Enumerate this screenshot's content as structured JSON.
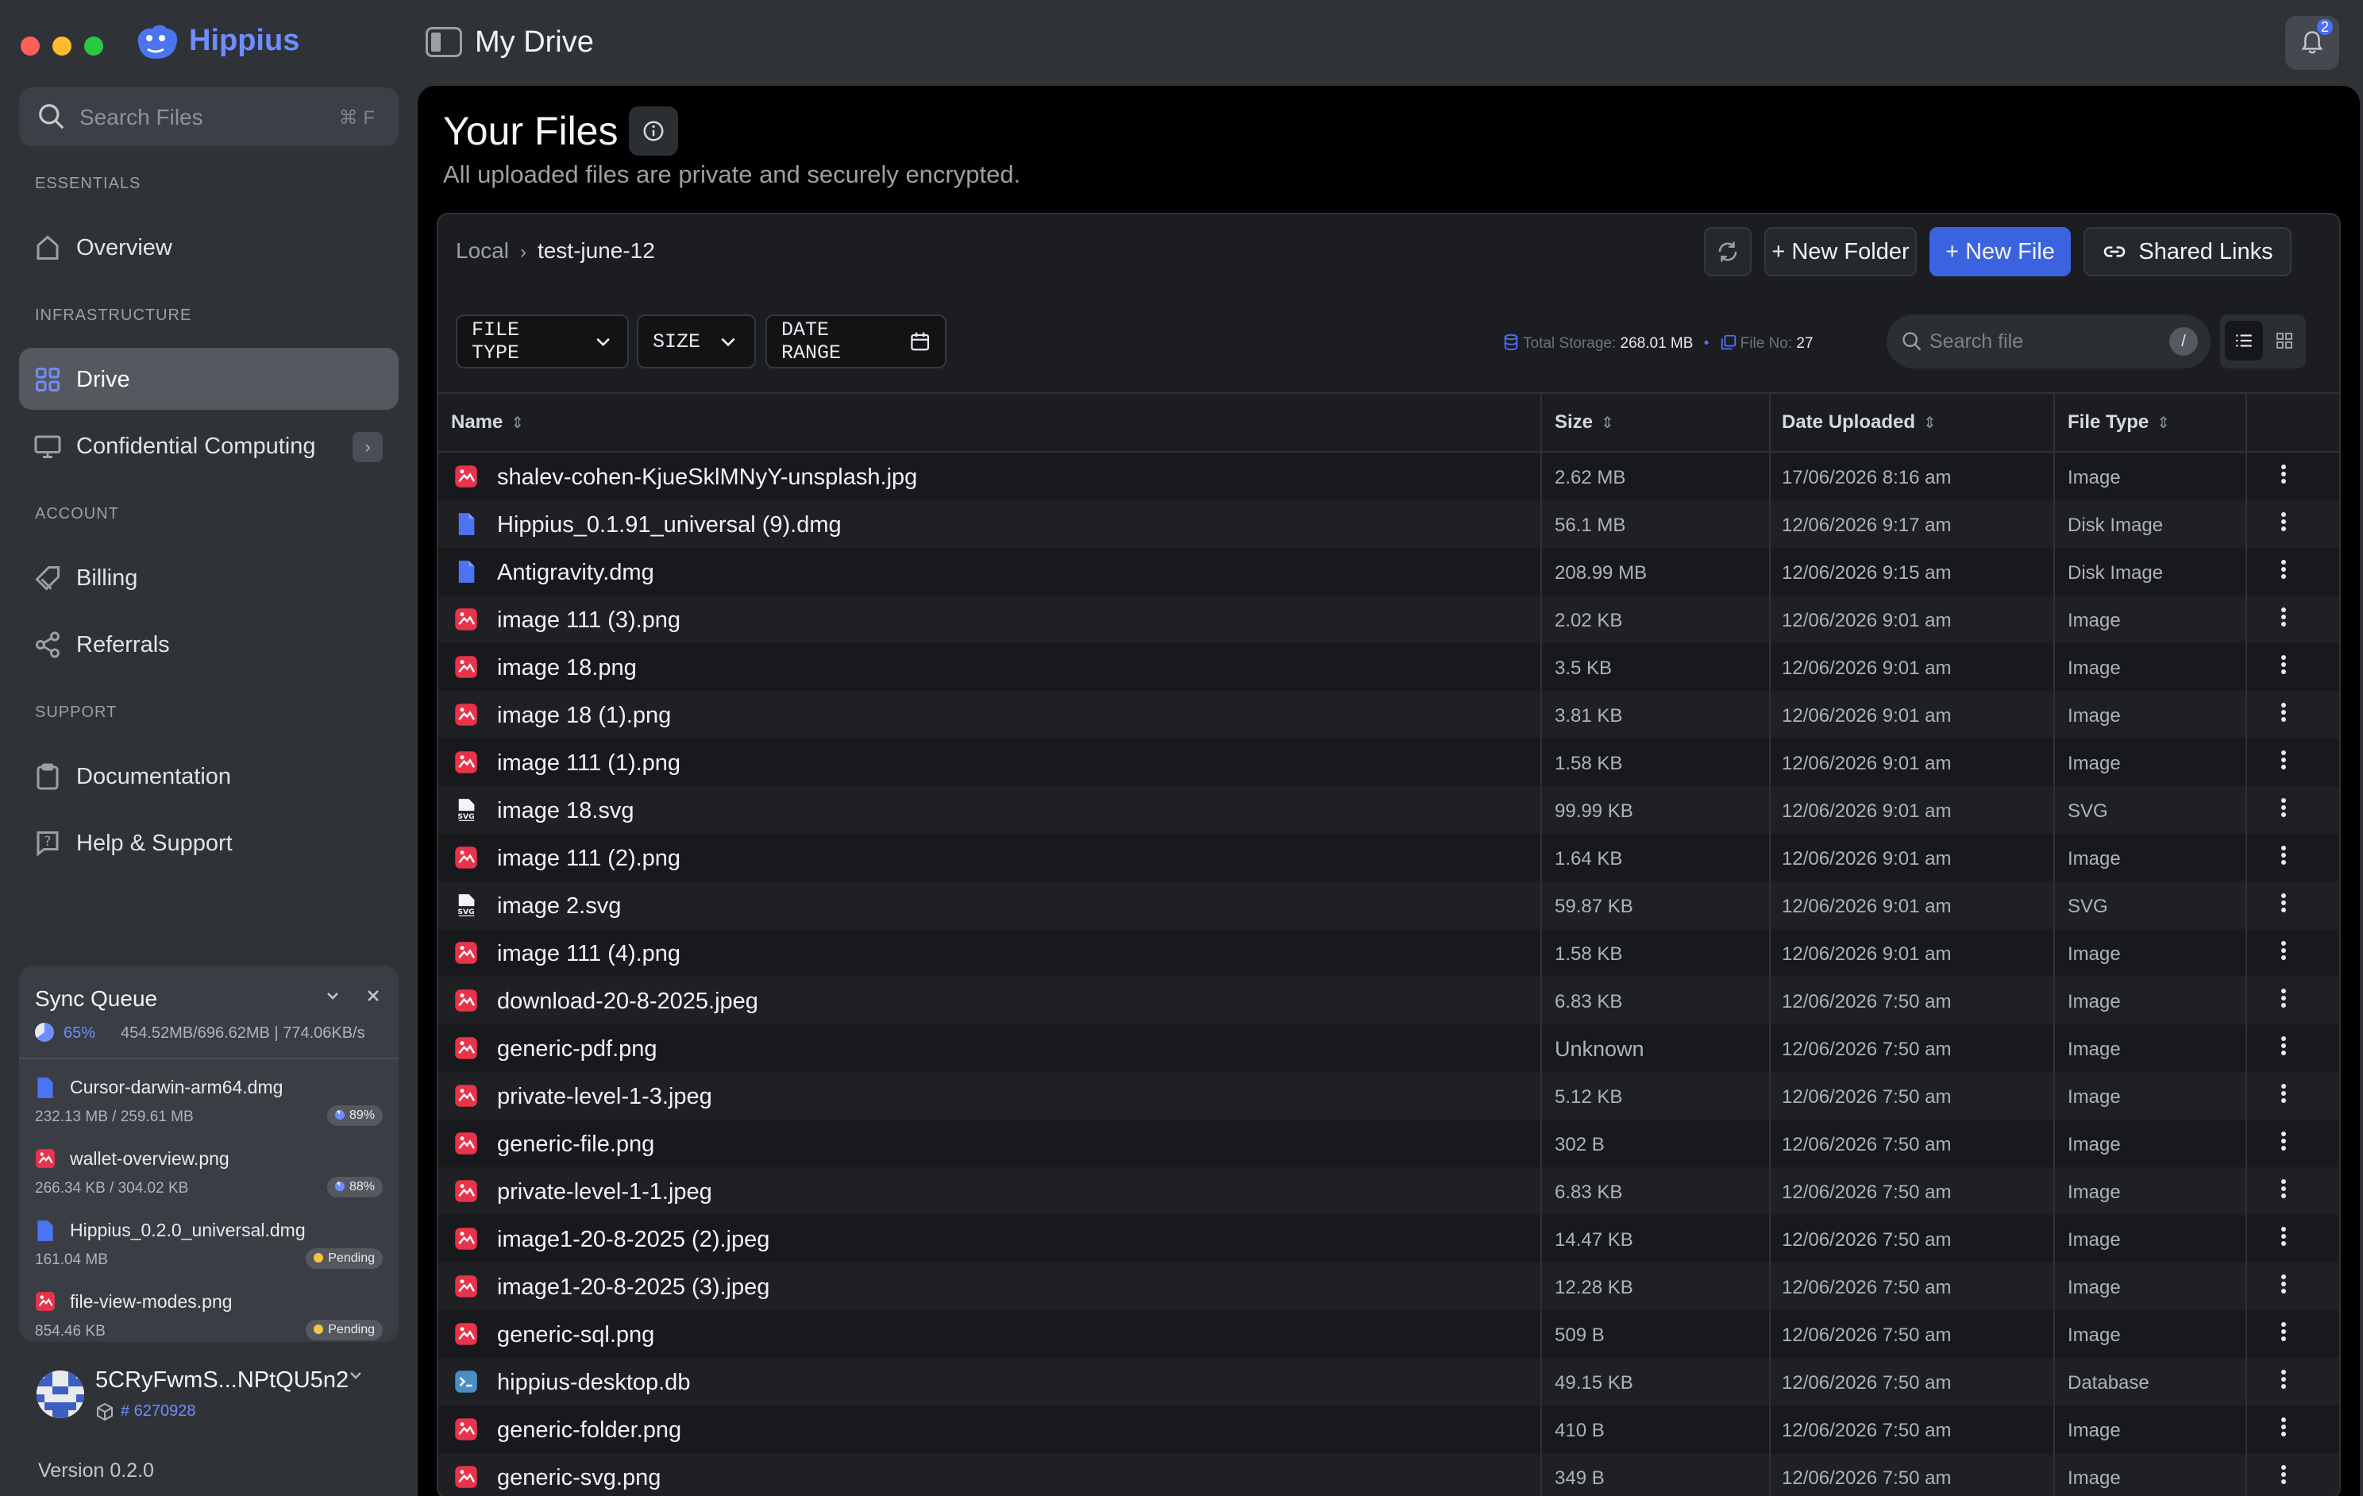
{
  "app": {
    "brand": "Hippius",
    "page_heading": "My Drive",
    "notification_count": "2"
  },
  "sidebar": {
    "search_placeholder": "Search Files",
    "search_shortcut": "⌘ F",
    "sections": {
      "essentials": "ESSENTIALS",
      "infrastructure": "INFRASTRUCTURE",
      "account": "ACCOUNT",
      "support": "SUPPORT"
    },
    "items": {
      "overview": "Overview",
      "drive": "Drive",
      "confidential": "Confidential Computing",
      "billing": "Billing",
      "referrals": "Referrals",
      "documentation": "Documentation",
      "help": "Help & Support"
    },
    "active_item": "drive"
  },
  "sync_queue": {
    "title": "Sync Queue",
    "percent": "65%",
    "progress_fraction": 0.65,
    "stats": "454.52MB/696.62MB  |  774.06KB/s",
    "items": [
      {
        "name": "Cursor-darwin-arm64.dmg",
        "size": "232.13 MB / 259.61 MB",
        "status": "89%",
        "kind": "file",
        "state": "progress"
      },
      {
        "name": "wallet-overview.png",
        "size": "266.34 KB / 304.02 KB",
        "status": "88%",
        "kind": "image",
        "state": "progress"
      },
      {
        "name": "Hippius_0.2.0_universal.dmg",
        "size": "161.04 MB",
        "status": "Pending",
        "kind": "file",
        "state": "pending"
      },
      {
        "name": "file-view-modes.png",
        "size": "854.46 KB",
        "status": "Pending",
        "kind": "image",
        "state": "pending"
      }
    ]
  },
  "account": {
    "name": "5CRyFwmS...NPtQU5n2",
    "id": "# 6270928"
  },
  "version": "Version 0.2.0",
  "main": {
    "title": "Your Files",
    "subtitle": "All uploaded files are private and securely encrypted.",
    "breadcrumb": {
      "root": "Local",
      "current": "test-june-12"
    },
    "buttons": {
      "new_folder": "+ New Folder",
      "new_file": "+ New File",
      "shared_links": "Shared Links"
    },
    "filters": {
      "file_type": "FILE TYPE",
      "size": "SIZE",
      "date_range": "DATE RANGE"
    },
    "stats": {
      "storage_label": "Total Storage:",
      "storage_value": "268.01 MB",
      "count_label": "File No:",
      "count_value": "27"
    },
    "search_placeholder": "Search file",
    "search_shortcut": "/",
    "columns": {
      "name": "Name",
      "size": "Size",
      "date": "Date Uploaded",
      "type": "File Type"
    },
    "files": [
      {
        "name": "shalev-cohen-KjueSklMNyY-unsplash.jpg",
        "size": "2.62 MB",
        "date": "17/06/2026 8:16 am",
        "type": "Image",
        "icon": "image"
      },
      {
        "name": "Hippius_0.1.91_universal (9).dmg",
        "size": "56.1 MB",
        "date": "12/06/2026 9:17 am",
        "type": "Disk Image",
        "icon": "file"
      },
      {
        "name": "Antigravity.dmg",
        "size": "208.99 MB",
        "date": "12/06/2026 9:15 am",
        "type": "Disk Image",
        "icon": "file"
      },
      {
        "name": "image 111 (3).png",
        "size": "2.02 KB",
        "date": "12/06/2026 9:01 am",
        "type": "Image",
        "icon": "image"
      },
      {
        "name": "image 18.png",
        "size": "3.5 KB",
        "date": "12/06/2026 9:01 am",
        "type": "Image",
        "icon": "image"
      },
      {
        "name": "image 18 (1).png",
        "size": "3.81 KB",
        "date": "12/06/2026 9:01 am",
        "type": "Image",
        "icon": "image"
      },
      {
        "name": "image 111 (1).png",
        "size": "1.58 KB",
        "date": "12/06/2026 9:01 am",
        "type": "Image",
        "icon": "image"
      },
      {
        "name": "image 18.svg",
        "size": "99.99 KB",
        "date": "12/06/2026 9:01 am",
        "type": "SVG",
        "icon": "svg"
      },
      {
        "name": "image 111 (2).png",
        "size": "1.64 KB",
        "date": "12/06/2026 9:01 am",
        "type": "Image",
        "icon": "image"
      },
      {
        "name": "image 2.svg",
        "size": "59.87 KB",
        "date": "12/06/2026 9:01 am",
        "type": "SVG",
        "icon": "svg"
      },
      {
        "name": "image 111 (4).png",
        "size": "1.58 KB",
        "date": "12/06/2026 9:01 am",
        "type": "Image",
        "icon": "image"
      },
      {
        "name": "download-20-8-2025.jpeg",
        "size": "6.83 KB",
        "date": "12/06/2026 7:50 am",
        "type": "Image",
        "icon": "image"
      },
      {
        "name": "generic-pdf.png",
        "size": "Unknown",
        "date": "12/06/2026 7:50 am",
        "type": "Image",
        "icon": "image"
      },
      {
        "name": "private-level-1-3.jpeg",
        "size": "5.12 KB",
        "date": "12/06/2026 7:50 am",
        "type": "Image",
        "icon": "image"
      },
      {
        "name": "generic-file.png",
        "size": "302 B",
        "date": "12/06/2026 7:50 am",
        "type": "Image",
        "icon": "image"
      },
      {
        "name": "private-level-1-1.jpeg",
        "size": "6.83 KB",
        "date": "12/06/2026 7:50 am",
        "type": "Image",
        "icon": "image"
      },
      {
        "name": "image1-20-8-2025 (2).jpeg",
        "size": "14.47 KB",
        "date": "12/06/2026 7:50 am",
        "type": "Image",
        "icon": "image"
      },
      {
        "name": "image1-20-8-2025 (3).jpeg",
        "size": "12.28 KB",
        "date": "12/06/2026 7:50 am",
        "type": "Image",
        "icon": "image"
      },
      {
        "name": "generic-sql.png",
        "size": "509 B",
        "date": "12/06/2026 7:50 am",
        "type": "Image",
        "icon": "image"
      },
      {
        "name": "hippius-desktop.db",
        "size": "49.15 KB",
        "date": "12/06/2026 7:50 am",
        "type": "Database",
        "icon": "database"
      },
      {
        "name": "generic-folder.png",
        "size": "410 B",
        "date": "12/06/2026 7:50 am",
        "type": "Image",
        "icon": "image"
      },
      {
        "name": "generic-svg.png",
        "size": "349 B",
        "date": "12/06/2026 7:50 am",
        "type": "Image",
        "icon": "image"
      }
    ]
  },
  "colors": {
    "accent": "#3b63e0",
    "brand": "#6f8dff",
    "image_icon": "#e8334a",
    "file_icon": "#4c73f0",
    "pending": "#f5c542"
  }
}
